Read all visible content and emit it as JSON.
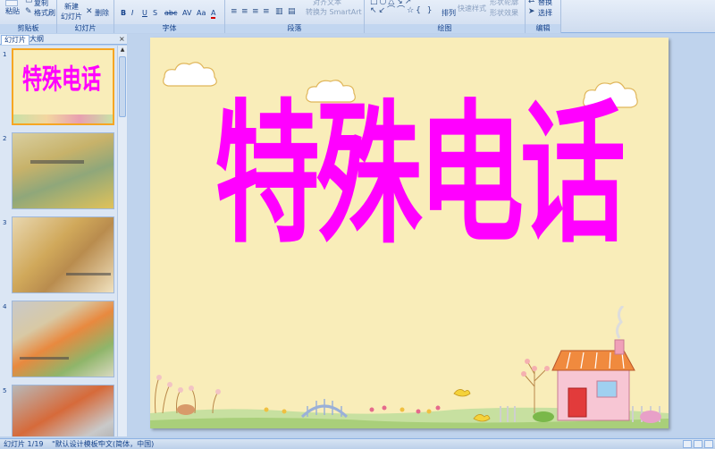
{
  "ribbon": {
    "clipboard": {
      "paste": "粘贴",
      "copy": "复制",
      "format_painter": "格式刷",
      "label": "剪贴板"
    },
    "slides": {
      "new_slide_line1": "新建",
      "new_slide_line2": "幻灯片",
      "delete": "删除",
      "label": "幻灯片"
    },
    "font": {
      "bold": "B",
      "italic": "I",
      "underline": "U",
      "shadow": "S",
      "strike": "abc",
      "spacing": "AV",
      "case": "Aa",
      "color": "A",
      "label": "字体"
    },
    "paragraph": {
      "smartart": "转换为 SmartArt",
      "text_direction": "对齐文本",
      "label": "段落"
    },
    "drawing": {
      "arrange": "排列",
      "quick_styles": "快速样式",
      "shape_outline": "形状轮廓",
      "shape_effects": "形状效果",
      "label": "绘图"
    },
    "editing": {
      "replace": "替换",
      "select": "选择",
      "label": "编辑"
    }
  },
  "panel": {
    "tab_slides": "幻灯片",
    "tab_outline": "大纲",
    "close": "×"
  },
  "thumbnails": [
    {
      "num": "1",
      "title": "特殊电话"
    },
    {
      "num": "2",
      "title": ""
    },
    {
      "num": "3",
      "title": ""
    },
    {
      "num": "4",
      "title": ""
    },
    {
      "num": "5",
      "title": ""
    }
  ],
  "slide": {
    "title": "特殊电话"
  },
  "status": {
    "slide_counter": "幻灯片 1/19",
    "theme": "\"默认设计模板\"",
    "language": "中文(简体，中国)"
  },
  "colors": {
    "title": "#ff00ff",
    "slide_bg": "#f9edb9",
    "ribbon": "#dbe6f4"
  }
}
